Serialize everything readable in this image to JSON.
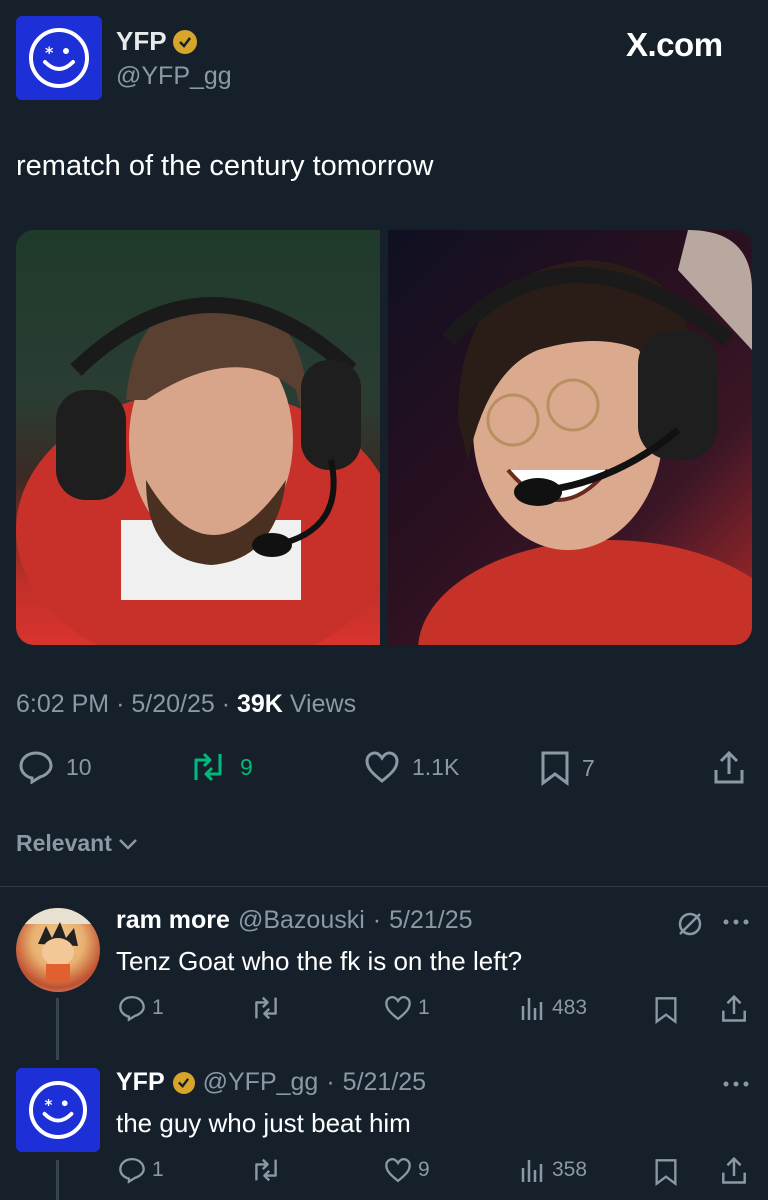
{
  "header": {
    "name": "YFP",
    "handle": "@YFP_gg",
    "brand": "X.com"
  },
  "tweet": {
    "text": "rematch of the century tomorrow",
    "time": "6:02 PM",
    "date": "5/20/25",
    "views_count": "39K",
    "views_label": "Views",
    "sep": "·"
  },
  "actions": {
    "replies": "10",
    "reposts": "9",
    "likes": "1.1K",
    "bookmarks": "7"
  },
  "sort": {
    "label": "Relevant"
  },
  "replies": [
    {
      "name": "ram more",
      "handle": "@Bazouski",
      "date": "5/21/25",
      "text": "Tenz Goat who the fk is on the left?",
      "replies": "1",
      "likes": "1",
      "views": "483"
    },
    {
      "name": "YFP",
      "handle": "@YFP_gg",
      "date": "5/21/25",
      "text": "the guy who just beat him",
      "replies": "1",
      "likes": "9",
      "views": "358"
    }
  ],
  "colors": {
    "background": "#15202b",
    "text": "#e7e9ea",
    "muted": "#8b98a5",
    "repost_active": "#00ba7c",
    "avatar_blue": "#1d2fd6",
    "verified_gold": "#d6a52a"
  },
  "icons": [
    "smiley-avatar-icon",
    "verified-badge-icon",
    "reply-icon",
    "repost-icon",
    "like-icon",
    "bookmark-icon",
    "share-icon",
    "views-icon",
    "more-icon",
    "grok-icon",
    "chevron-down-icon"
  ]
}
